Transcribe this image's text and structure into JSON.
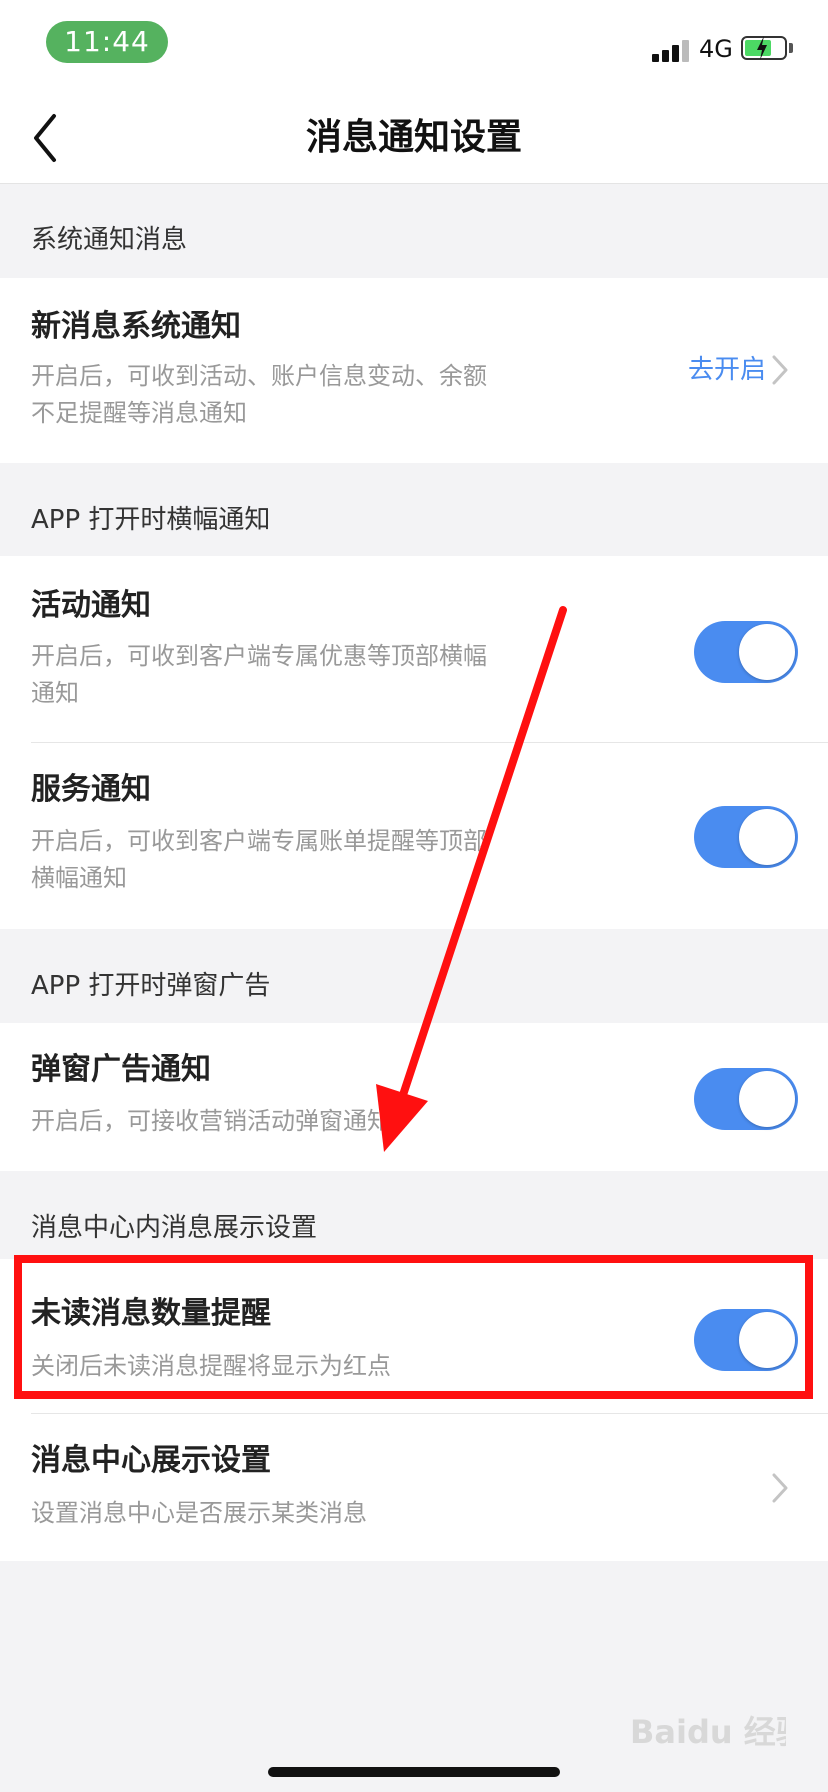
{
  "status_bar": {
    "time": "11:44",
    "network": "4G"
  },
  "nav": {
    "title": "消息通知设置"
  },
  "sections": [
    {
      "header": "系统通知消息",
      "rows": [
        {
          "title": "新消息系统通知",
          "desc_line1": "开启后，可收到活动、账户信息变动、余额",
          "desc_line2": "不足提醒等消息通知",
          "action_label": "去开启"
        }
      ]
    },
    {
      "header": "APP 打开时横幅通知",
      "rows": [
        {
          "title": "活动通知",
          "desc_line1": "开启后，可收到客户端专属优惠等顶部横幅",
          "desc_line2": "通知",
          "toggle_on": true
        },
        {
          "title": "服务通知",
          "desc_line1": "开启后，可收到客户端专属账单提醒等顶部",
          "desc_line2": "横幅通知",
          "toggle_on": true
        }
      ]
    },
    {
      "header": "APP 打开时弹窗广告",
      "rows": [
        {
          "title": "弹窗广告通知",
          "desc_line1": "开启后，可接收营销活动弹窗通知",
          "toggle_on": true
        }
      ]
    },
    {
      "header": "消息中心内消息展示设置",
      "rows": [
        {
          "title": "未读消息数量提醒",
          "desc_line1": "关闭后未读消息提醒将显示为红点",
          "toggle_on": true
        },
        {
          "title": "消息中心展示设置",
          "desc_line1": "设置消息中心是否展示某类消息"
        }
      ]
    }
  ],
  "watermark": {
    "text": "Baidu 经验"
  },
  "colors": {
    "accent": "#4a8cf0",
    "status_pill": "#55b25f",
    "annotation": "#ff1010",
    "background": "#f3f3f5"
  },
  "icons": [
    "back-arrow-icon",
    "chevron-right-icon",
    "signal-icon",
    "battery-charging-icon"
  ]
}
